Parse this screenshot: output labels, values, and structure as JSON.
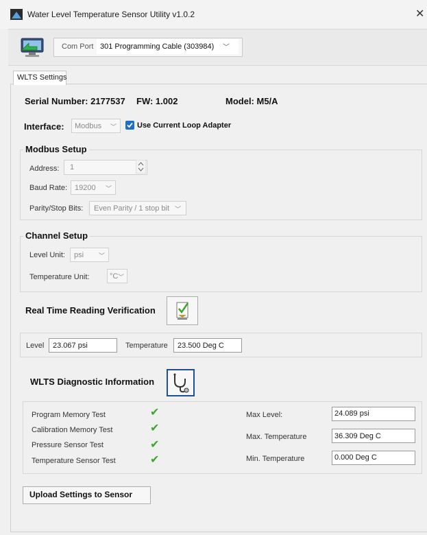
{
  "window": {
    "title": "Water Level Temperature Sensor Utility v1.0.2",
    "close_glyph": "✕"
  },
  "toolbar": {
    "com_port_label": "Com Port",
    "com_port_value": "301 Programming Cable (303984)",
    "chevron": "﹀"
  },
  "tab": {
    "label": "WLTS Settings"
  },
  "device": {
    "serial_text": "Serial Number: 2177537",
    "fw_text": "FW: 1.002",
    "model_text": "Model: M5/A"
  },
  "interface": {
    "label": "Interface:",
    "value": "Modbus",
    "use_current_loop_label": "Use Current Loop Adapter",
    "use_current_loop_checked": true
  },
  "modbus": {
    "title": "Modbus Setup",
    "address_label": "Address:",
    "address_value": "1",
    "baud_label": "Baud Rate:",
    "baud_value": "19200",
    "parity_label": "Parity/Stop Bits:",
    "parity_value": "Even Parity / 1 stop bit"
  },
  "channel": {
    "title": "Channel Setup",
    "level_unit_label": "Level Unit:",
    "level_unit_value": "psi",
    "temp_unit_label": "Temperature Unit:",
    "temp_unit_value": "°C"
  },
  "realtime": {
    "title": "Real Time Reading Verification",
    "level_label": "Level",
    "level_value": "23.067 psi",
    "temperature_label": "Temperature",
    "temperature_value": "23.500 Deg C"
  },
  "diagnostics": {
    "title": "WLTS Diagnostic Information",
    "tests": [
      {
        "label": "Program Memory Test",
        "passed": true
      },
      {
        "label": "Calibration Memory Test",
        "passed": true
      },
      {
        "label": "Pressure Sensor Test",
        "passed": true
      },
      {
        "label": "Temperature Sensor Test",
        "passed": true
      }
    ],
    "check_glyph": "✔",
    "max_level_label": "Max Level:",
    "max_level_value": "24.089 psi",
    "max_temp_label": "Max. Temperature",
    "max_temp_value": "36.309 Deg C",
    "min_temp_label": "Min. Temperature",
    "min_temp_value": "0.000 Deg C"
  },
  "upload": {
    "label": "Upload Settings to Sensor"
  },
  "icons": {
    "app": "sensor-app-icon",
    "connect": "connect-computer-icon",
    "verify": "checklist-icon",
    "diagnostic": "stethoscope-icon"
  },
  "colors": {
    "accent": "#1f6fc4",
    "check": "#3ca52c"
  }
}
